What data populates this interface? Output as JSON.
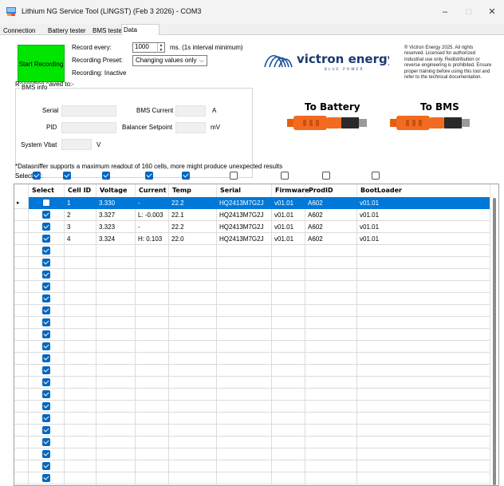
{
  "window": {
    "title": "Lithium NG Service Tool (LINGST) (Feb  3 2026) - COM3",
    "minimize": "–",
    "maximize": "□",
    "close": "✕"
  },
  "tabs": [
    "Connection",
    "Battery tester",
    "BMS tester",
    "Data Sniffer"
  ],
  "active_tab": "Data Sniffer",
  "recording": {
    "start_label": "Start Recording",
    "record_every_label": "Record every:",
    "interval_value": "1000",
    "interval_unit": "ms. (1s interval minimum)",
    "preset_label": "Recording Preset:",
    "preset_value": "Changing values only",
    "status": "Recording: Inactive",
    "saved_to_label": "Recording saved to:",
    "saved_to_value": "-"
  },
  "bms_info": {
    "legend": "BMS info",
    "serial_label": "Serial",
    "pid_label": "PID",
    "bms_current_label": "BMS Current",
    "bms_current_unit": "A",
    "balancer_label": "Balancer Setpoint",
    "balancer_unit": "mV",
    "vbat_label": "System Vbat",
    "vbat_unit": "V"
  },
  "branding": {
    "logo_word": "victron energy",
    "logo_sub": "BLUE  POWER",
    "copyright": "® Victron Energy 2025. All rights reserved. Licensed for authorized industrial use only. Redistribution or reverse engineering is prohibited. Ensure proper training before using this tool and refer to the technical documentation.",
    "to_battery": "To Battery",
    "to_bms": "To BMS",
    "brand_color": "#1a4fa0",
    "connector_color": "#f26b21"
  },
  "note": "*Datasniffer supports a maximum readout of 160 cells, more might produce unexpected results",
  "select_all_label": "Select all:",
  "select_all_states": [
    true,
    true,
    true,
    true,
    true,
    false,
    false,
    false,
    false
  ],
  "grid": {
    "columns": [
      "Select",
      "Cell ID",
      "Voltage",
      "Current",
      "Temp",
      "Serial",
      "Firmware",
      "ProdID",
      "BootLoader"
    ],
    "rows": [
      {
        "cell": "1",
        "voltage": "3.330",
        "current": "-",
        "temp": "22.2",
        "serial": "HQ2413M7G2J",
        "firmware": "v01.01",
        "prodid": "A602",
        "boot": "v01.01"
      },
      {
        "cell": "2",
        "voltage": "3.327",
        "current": "L: -0.003",
        "temp": "22.1",
        "serial": "HQ2413M7G2J",
        "firmware": "v01.01",
        "prodid": "A602",
        "boot": "v01.01"
      },
      {
        "cell": "3",
        "voltage": "3.323",
        "current": "-",
        "temp": "22.2",
        "serial": "HQ2413M7G2J",
        "firmware": "v01.01",
        "prodid": "A602",
        "boot": "v01.01"
      },
      {
        "cell": "4",
        "voltage": "3.324",
        "current": "H: 0.103",
        "temp": "22.0",
        "serial": "HQ2413M7G2J",
        "firmware": "v01.01",
        "prodid": "A602",
        "boot": "v01.01"
      }
    ],
    "selected_row": 0,
    "row_pointer": "▸"
  }
}
